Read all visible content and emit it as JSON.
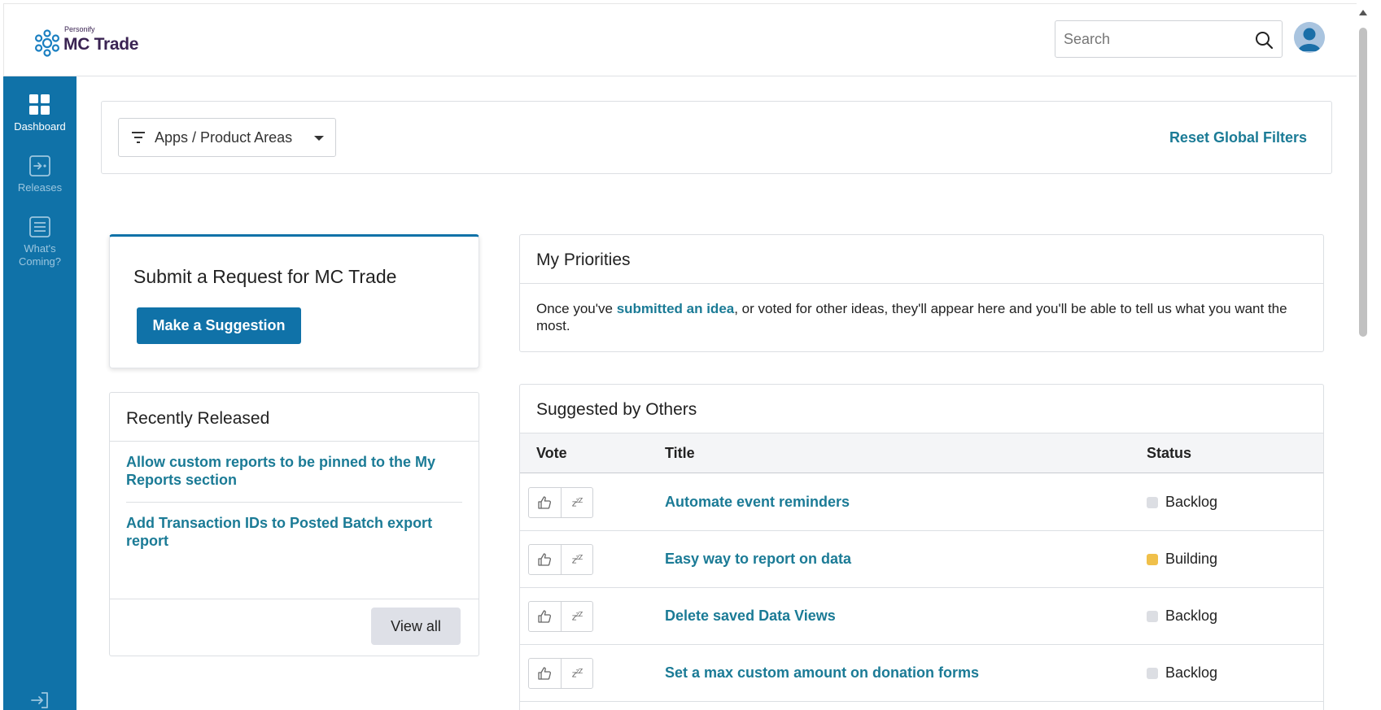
{
  "header": {
    "logo_small": "Personify",
    "logo_main": "MC Trade",
    "search_placeholder": "Search"
  },
  "sidebar": {
    "items": [
      {
        "label": "Dashboard",
        "icon": "dashboard-grid-icon",
        "active": true
      },
      {
        "label": "Releases",
        "icon": "release-icon",
        "active": false
      },
      {
        "label_line1": "What's",
        "label_line2": "Coming?",
        "icon": "list-icon",
        "active": false
      }
    ],
    "logout_icon": "logout-icon"
  },
  "filters": {
    "dropdown_label": "Apps / Product Areas",
    "reset_label": "Reset Global Filters"
  },
  "submit_card": {
    "title": "Submit a Request for MC Trade",
    "button_label": "Make a Suggestion"
  },
  "recently_released": {
    "title": "Recently Released",
    "items": [
      "Allow custom reports to be pinned to the My Reports section",
      "Add Transaction IDs to Posted Batch export report"
    ],
    "view_all_label": "View all"
  },
  "my_priorities": {
    "title": "My Priorities",
    "text_before": "Once you've ",
    "link_text": "submitted an idea",
    "text_after": ", or voted for other ideas, they'll appear here and you'll be able to tell us what you want the most."
  },
  "suggested_by_others": {
    "title": "Suggested by Others",
    "columns": {
      "vote": "Vote",
      "title": "Title",
      "status": "Status"
    },
    "rows": [
      {
        "title": "Automate event reminders",
        "status": "Backlog",
        "status_color": "#dcdee3"
      },
      {
        "title": "Easy way to report on data",
        "status": "Building",
        "status_color": "#f0c04a"
      },
      {
        "title": "Delete saved Data Views",
        "status": "Backlog",
        "status_color": "#dcdee3"
      },
      {
        "title": "Set a max custom amount on donation forms",
        "status": "Backlog",
        "status_color": "#dcdee3"
      }
    ]
  },
  "colors": {
    "primary": "#1072a8",
    "link": "#1b7b96",
    "brand_text": "#3a2352"
  }
}
